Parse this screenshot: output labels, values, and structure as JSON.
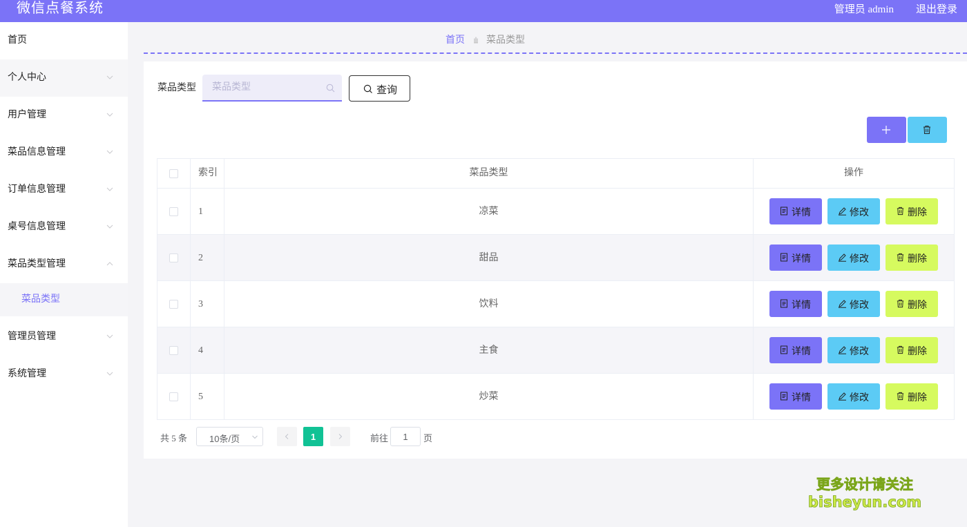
{
  "header": {
    "app_title": "微信点餐系统",
    "user_info": "管理员 admin",
    "logout_label": "退出登录"
  },
  "sidebar": {
    "items": [
      {
        "label": "首页"
      },
      {
        "label": "个人中心"
      },
      {
        "label": "用户管理"
      },
      {
        "label": "菜品信息管理"
      },
      {
        "label": "订单信息管理"
      },
      {
        "label": "桌号信息管理"
      },
      {
        "label": "菜品类型管理",
        "expanded": true,
        "children": [
          {
            "label": "菜品类型",
            "active": true
          }
        ]
      },
      {
        "label": "管理员管理"
      },
      {
        "label": "系统管理"
      }
    ]
  },
  "breadcrumb": {
    "home": "首页",
    "current": "菜品类型"
  },
  "search": {
    "label": "菜品类型",
    "placeholder": "菜品类型",
    "value": "",
    "button_label": "查询"
  },
  "toolbar": {
    "add_icon": "plus-icon",
    "delete_icon": "trash-icon"
  },
  "table": {
    "columns": [
      "索引",
      "菜品类型",
      "操作"
    ],
    "rows": [
      {
        "index": "1",
        "type": "凉菜"
      },
      {
        "index": "2",
        "type": "甜品"
      },
      {
        "index": "3",
        "type": "饮料"
      },
      {
        "index": "4",
        "type": "主食"
      },
      {
        "index": "5",
        "type": "炒菜"
      }
    ],
    "actions": {
      "detail": "详情",
      "edit": "修改",
      "delete": "删除"
    }
  },
  "pagination": {
    "total_text": "共 5 条",
    "page_size": "10条/页",
    "current_page": "1",
    "goto_label": "前往",
    "goto_value": "1",
    "goto_suffix": "页"
  },
  "watermark": {
    "line1": "更多设计请关注",
    "line2": "bisheyun.com"
  },
  "colors": {
    "primary": "#7b73f7",
    "info": "#5ccbf5",
    "lime": "#d6fa5f",
    "page_active": "#11c295"
  }
}
